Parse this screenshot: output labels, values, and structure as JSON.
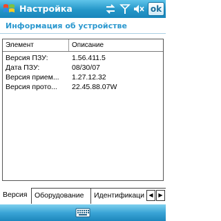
{
  "titlebar": {
    "title": "Настройка",
    "ok_label": "ok"
  },
  "header": {
    "title": "Информация об устройстве"
  },
  "list": {
    "columns": [
      "Элемент",
      "Описание"
    ],
    "rows": [
      {
        "name": "Версия ПЗУ:",
        "value": "1.56.411.5"
      },
      {
        "name": "Дата ПЗУ:",
        "value": "08/30/07"
      },
      {
        "name": "Версия прием...",
        "value": "1.27.12.32"
      },
      {
        "name": "Версия прото...",
        "value": "22.45.88.07W"
      }
    ]
  },
  "tabs": [
    {
      "label": "Версия",
      "active": true
    },
    {
      "label": "Оборудование",
      "active": false
    },
    {
      "label": "Идентификаци",
      "active": false
    }
  ],
  "icons": {
    "start": "windows-flag-icon",
    "tray": [
      "connectivity-icon",
      "signal-antenna-icon",
      "volume-muted-icon"
    ],
    "input": "keyboard-icon"
  },
  "colors": {
    "titlebar": "#2596c8",
    "header_text": "#2b98cf"
  }
}
